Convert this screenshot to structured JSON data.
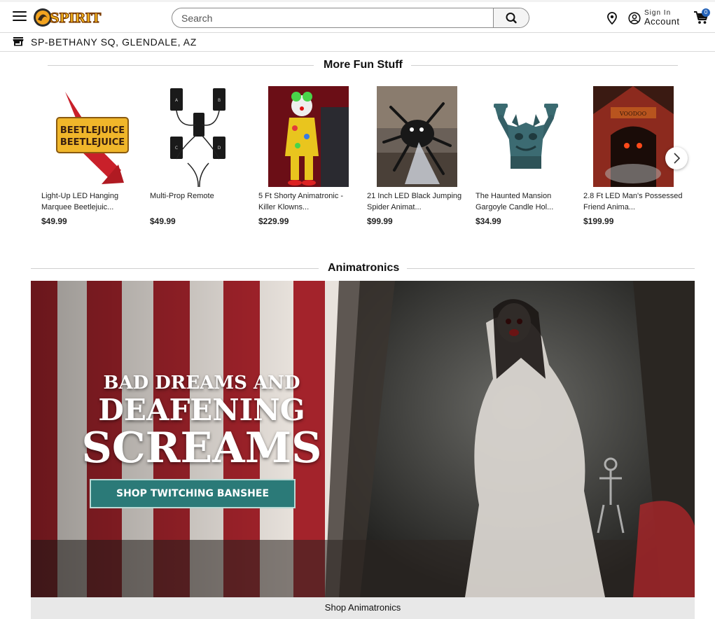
{
  "header": {
    "brand": "SPIRIT",
    "search": {
      "placeholder": "Search",
      "value": ""
    },
    "account": {
      "sign_in": "Sign In",
      "label": "Account"
    },
    "cart_count": "0"
  },
  "store": {
    "name": "SP-BETHANY SQ, GLENDALE, AZ"
  },
  "more_fun": {
    "title": "More Fun Stuff",
    "products": [
      {
        "name": "Light-Up LED Hanging Marquee Beetlejuic...",
        "price": "$49.99",
        "sign_text": "BEETLEJUICE"
      },
      {
        "name": "Multi-Prop Remote",
        "price": "$49.99",
        "keys": [
          "A",
          "B",
          "C",
          "D"
        ]
      },
      {
        "name": "5 Ft Shorty Animatronic - Killer Klowns...",
        "price": "$229.99"
      },
      {
        "name": "21 Inch LED Black Jumping Spider Animat...",
        "price": "$99.99"
      },
      {
        "name": "The Haunted Mansion Gargoyle Candle Hol...",
        "price": "$34.99"
      },
      {
        "name": "2.8 Ft LED Man's Possessed Friend Anima...",
        "price": "$199.99",
        "sign_text": "VOODOO"
      }
    ]
  },
  "animatronics": {
    "title": "Animatronics",
    "banner": {
      "line1": "BAD DREAMS AND",
      "line2": "DEAFENING",
      "line3": "SCREAMS",
      "cta": "SHOP TWITCHING BANSHEE"
    },
    "shop_link": "Shop Animatronics"
  },
  "icons": {
    "menu": "hamburger-menu-icon",
    "search": "search-icon",
    "location": "location-pin-icon",
    "account": "user-circle-icon",
    "cart": "cart-icon",
    "store": "storefront-icon",
    "next": "chevron-right-icon"
  },
  "colors": {
    "cart_badge": "#2563b8",
    "banner_cta": "#2b7a78",
    "stripe_red": "#a3232b"
  }
}
